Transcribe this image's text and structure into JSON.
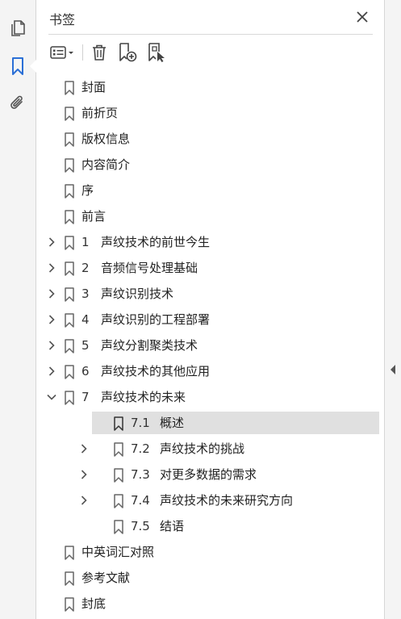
{
  "panel": {
    "title": "书签"
  },
  "rail": {
    "icons": [
      "pages-icon",
      "bookmark-icon",
      "attachment-icon"
    ],
    "active": "bookmark-icon",
    "accent": "#2b6fd6"
  },
  "toolbar": {
    "buttons": [
      "options-menu",
      "delete",
      "new-bookmark",
      "new-bookmark-from-selection"
    ]
  },
  "tree": {
    "items": [
      {
        "num": "",
        "label": "封面",
        "level": 0,
        "expand": "none"
      },
      {
        "num": "",
        "label": "前折页",
        "level": 0,
        "expand": "none"
      },
      {
        "num": "",
        "label": "版权信息",
        "level": 0,
        "expand": "none"
      },
      {
        "num": "",
        "label": "内容简介",
        "level": 0,
        "expand": "none"
      },
      {
        "num": "",
        "label": "序",
        "level": 0,
        "expand": "none"
      },
      {
        "num": "",
        "label": "前言",
        "level": 0,
        "expand": "none"
      },
      {
        "num": "1",
        "label": "声纹技术的前世今生",
        "level": 0,
        "expand": "collapsed"
      },
      {
        "num": "2",
        "label": "音频信号处理基础",
        "level": 0,
        "expand": "collapsed"
      },
      {
        "num": "3",
        "label": "声纹识别技术",
        "level": 0,
        "expand": "collapsed"
      },
      {
        "num": "4",
        "label": "声纹识别的工程部署",
        "level": 0,
        "expand": "collapsed"
      },
      {
        "num": "5",
        "label": "声纹分割聚类技术",
        "level": 0,
        "expand": "collapsed"
      },
      {
        "num": "6",
        "label": "声纹技术的其他应用",
        "level": 0,
        "expand": "collapsed"
      },
      {
        "num": "7",
        "label": "声纹技术的未来",
        "level": 0,
        "expand": "expanded"
      },
      {
        "num": "7.1",
        "label": "概述",
        "level": 1,
        "expand": "none",
        "selected": true
      },
      {
        "num": "7.2",
        "label": "声纹技术的挑战",
        "level": 1,
        "expand": "collapsed"
      },
      {
        "num": "7.3",
        "label": "对更多数据的需求",
        "level": 1,
        "expand": "collapsed"
      },
      {
        "num": "7.4",
        "label": "声纹技术的未来研究方向",
        "level": 1,
        "expand": "collapsed"
      },
      {
        "num": "7.5",
        "label": "结语",
        "level": 1,
        "expand": "none"
      },
      {
        "num": "",
        "label": "中英词汇对照",
        "level": 0,
        "expand": "none"
      },
      {
        "num": "",
        "label": "参考文献",
        "level": 0,
        "expand": "none"
      },
      {
        "num": "",
        "label": "封底",
        "level": 0,
        "expand": "none"
      }
    ]
  }
}
